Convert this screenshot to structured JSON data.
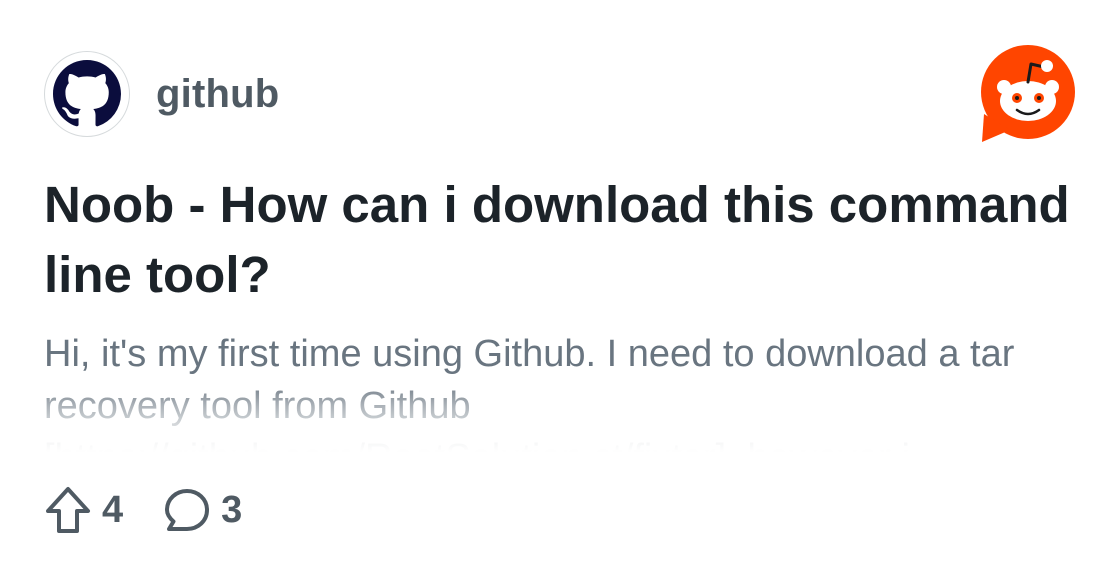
{
  "post": {
    "community": "github",
    "title": "Noob - How can i download this command line tool?",
    "body": "Hi, it's my first time using Github. I need to download a tar recovery tool from Github [https://github.com/RootSolution.st/fixtar], however i",
    "upvotes": "4",
    "comments": "3"
  },
  "icons": {
    "avatar": "github-octocat-icon",
    "brand": "reddit-logo-icon",
    "upvote": "upvote-arrow-icon",
    "comment": "comment-bubble-icon"
  },
  "colors": {
    "brand": "#ff4500",
    "title": "#1c2329",
    "body": "#697580",
    "meta": "#4f5a63"
  }
}
